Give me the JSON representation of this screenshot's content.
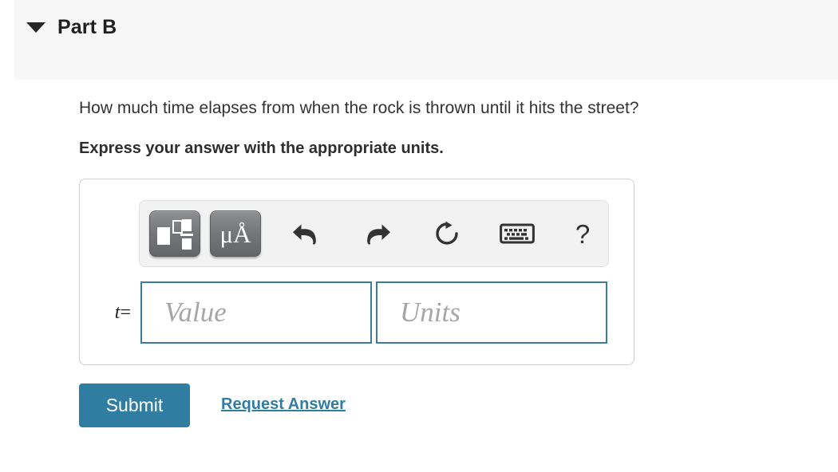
{
  "header": {
    "title": "Part B",
    "disclosure_icon": "triangle-down-icon",
    "expanded": "true"
  },
  "question": {
    "prompt": "How much time elapses from when the rock is thrown until it hits the street?",
    "instruction": "Express your answer with the appropriate units."
  },
  "toolbar": {
    "buttons": [
      {
        "name": "math-template-button",
        "icon": "math-template-icon",
        "label": "",
        "pressed_style": "dark"
      },
      {
        "name": "units-symbols-button",
        "icon": "mu-angstrom-icon",
        "label": "μÅ",
        "pressed_style": "dark"
      },
      {
        "name": "undo-button",
        "icon": "undo-arrow-icon",
        "label": ""
      },
      {
        "name": "redo-button",
        "icon": "redo-arrow-icon",
        "label": ""
      },
      {
        "name": "reset-button",
        "icon": "refresh-circular-arrow-icon",
        "label": ""
      },
      {
        "name": "keyboard-button",
        "icon": "keyboard-icon",
        "label": ""
      },
      {
        "name": "help-button",
        "icon": "question-mark-icon",
        "label": "?"
      }
    ]
  },
  "answer": {
    "variable_label": "t",
    "equals": "=",
    "value_field": {
      "value": "",
      "placeholder": "Value"
    },
    "units_field": {
      "value": "",
      "placeholder": "Units"
    }
  },
  "actions": {
    "submit_label": "Submit",
    "request_answer_label": "Request Answer"
  },
  "colors": {
    "accent": "#2f7da1",
    "field_border": "#3c7c9b",
    "header_bg": "#f7f7f7",
    "toolbar_bg": "#f2f2f2",
    "button_dark": "#76787c"
  }
}
